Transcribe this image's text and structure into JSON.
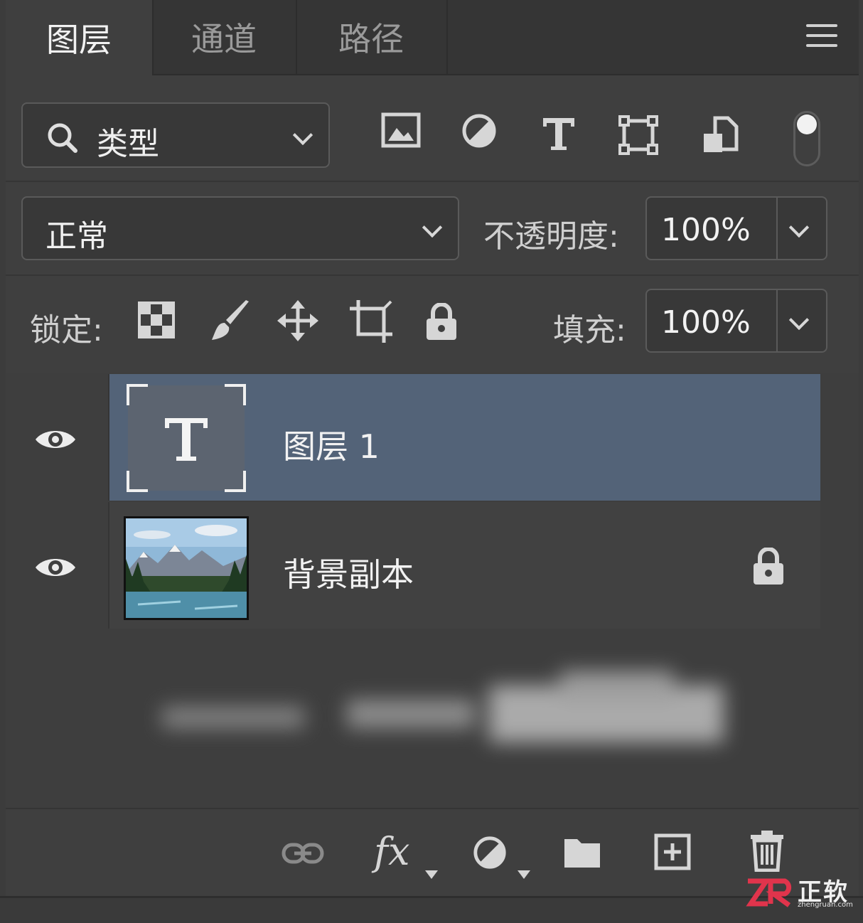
{
  "tabs": [
    {
      "label": "图层",
      "active": true
    },
    {
      "label": "通道",
      "active": false
    },
    {
      "label": "路径",
      "active": false
    }
  ],
  "filter": {
    "kind_label": "类型",
    "toggle_on": true
  },
  "filter_icons": [
    "image-filter-icon",
    "adjustment-filter-icon",
    "type-filter-icon",
    "shape-filter-icon",
    "smart-object-filter-icon"
  ],
  "blend": {
    "mode": "正常"
  },
  "opacity": {
    "label": "不透明度:",
    "value": "100%"
  },
  "lock": {
    "label": "锁定:",
    "icons": [
      "lock-transparent-icon",
      "lock-paint-icon",
      "lock-position-icon",
      "lock-artboard-icon",
      "lock-all-icon"
    ]
  },
  "fill": {
    "label": "填充:",
    "value": "100%"
  },
  "layers": [
    {
      "name": "图层 1",
      "type": "text",
      "visible": true,
      "selected": true,
      "locked": false
    },
    {
      "name": "背景副本",
      "type": "image",
      "visible": true,
      "selected": false,
      "locked": true
    }
  ],
  "footer_icons": [
    "link-layers-icon",
    "fx-icon",
    "adjustment-layer-icon",
    "group-folder-icon",
    "new-layer-icon",
    "trash-icon"
  ],
  "footer": {
    "fx_label": "fx"
  },
  "watermark": {
    "brand": "正软",
    "logo": "ZR",
    "url": "zhengruan.com"
  },
  "colors": {
    "selected_row": "#536378",
    "panel": "#3f3f3f",
    "watermark_red": "#e0344c"
  }
}
